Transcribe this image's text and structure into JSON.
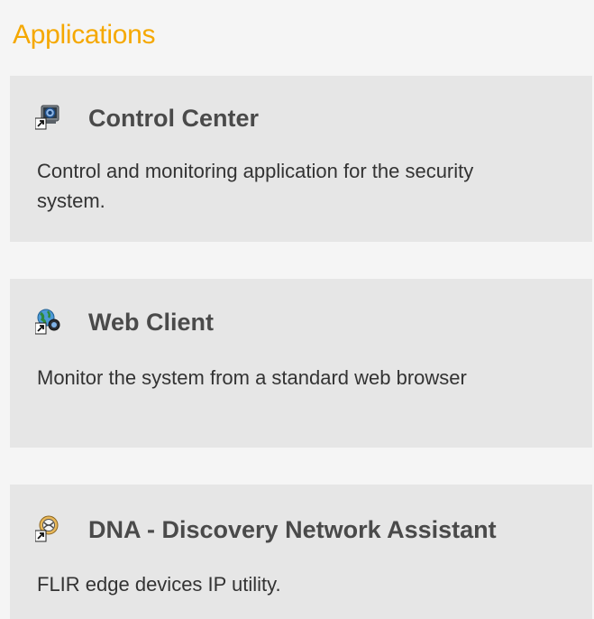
{
  "section": {
    "title": "Applications"
  },
  "apps": [
    {
      "name": "Control Center",
      "description": "Control and monitoring application for the security system.",
      "icon": "control-center-icon"
    },
    {
      "name": "Web Client",
      "description": "Monitor the system from a standard web browser",
      "icon": "web-client-icon"
    },
    {
      "name": "DNA - Discovery Network Assistant",
      "description": "FLIR edge devices IP utility.",
      "icon": "dna-icon"
    }
  ],
  "colors": {
    "title": "#f5a800",
    "card_background": "#e6e6e6",
    "page_background": "#f5f5f5",
    "app_name": "#4a4a4a",
    "description": "#333333"
  }
}
